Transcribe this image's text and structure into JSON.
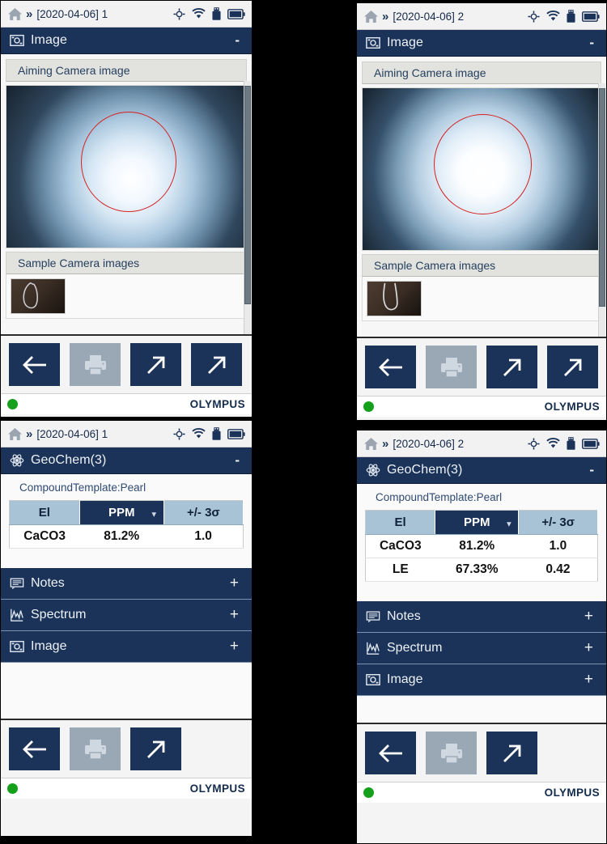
{
  "panels": {
    "tl": {
      "status": {
        "breadcrumb": "[2020-04-06] 1",
        "home_icon": "home-icon",
        "chevron": "»",
        "icons": [
          "gps-icon",
          "wifi-icon",
          "usb-icon",
          "battery-icon"
        ]
      },
      "section": {
        "title": "Image",
        "icon": "image-icon",
        "collapse": "-"
      },
      "sub_aiming": "Aiming Camera image",
      "sub_sample": "Sample Camera images",
      "toolbar": [
        {
          "name": "back-button",
          "icon": "arrow-left-icon",
          "disabled": false
        },
        {
          "name": "print-button",
          "icon": "printer-icon",
          "disabled": true
        },
        {
          "name": "export-button",
          "icon": "arrow-upright-icon",
          "disabled": false
        },
        {
          "name": "share-button",
          "icon": "arrow-upright-icon",
          "disabled": false
        }
      ],
      "footer": {
        "led": "status-led-green",
        "brand": "OLYMPUS"
      }
    },
    "tr": {
      "status": {
        "breadcrumb": "[2020-04-06] 2",
        "home_icon": "home-icon",
        "chevron": "»",
        "icons": [
          "gps-icon",
          "wifi-icon",
          "usb-icon",
          "battery-icon"
        ]
      },
      "section": {
        "title": "Image",
        "icon": "image-icon",
        "collapse": "-"
      },
      "sub_aiming": "Aiming Camera image",
      "sub_sample": "Sample Camera images",
      "toolbar": [
        {
          "name": "back-button",
          "icon": "arrow-left-icon",
          "disabled": false
        },
        {
          "name": "print-button",
          "icon": "printer-icon",
          "disabled": true
        },
        {
          "name": "export-button",
          "icon": "arrow-upright-icon",
          "disabled": false
        },
        {
          "name": "share-button",
          "icon": "arrow-upright-icon",
          "disabled": false
        }
      ],
      "footer": {
        "led": "status-led-green",
        "brand": "OLYMPUS"
      }
    },
    "bl": {
      "status": {
        "breadcrumb": "[2020-04-06] 1",
        "home_icon": "home-icon",
        "chevron": "»",
        "icons": [
          "gps-icon",
          "wifi-icon",
          "usb-icon",
          "battery-icon"
        ]
      },
      "section": {
        "title": "GeoChem(3)",
        "icon": "atom-icon",
        "collapse": "-"
      },
      "template_label": "CompoundTemplate:Pearl",
      "table": {
        "columns": [
          "El",
          "PPM",
          "+/- 3σ"
        ],
        "selected_column": "PPM",
        "rows": [
          {
            "el": "CaCO3",
            "ppm": "81.2%",
            "err": "1.0"
          }
        ]
      },
      "collapsed": [
        {
          "title": "Notes",
          "icon": "notes-icon",
          "expand": "+"
        },
        {
          "title": "Spectrum",
          "icon": "spectrum-icon",
          "expand": "+"
        },
        {
          "title": "Image",
          "icon": "image-icon",
          "expand": "+"
        }
      ],
      "toolbar": [
        {
          "name": "back-button",
          "icon": "arrow-left-icon",
          "disabled": false
        },
        {
          "name": "print-button",
          "icon": "printer-icon",
          "disabled": true
        },
        {
          "name": "export-button",
          "icon": "arrow-upright-icon",
          "disabled": false
        }
      ],
      "footer": {
        "led": "status-led-green",
        "brand": "OLYMPUS"
      }
    },
    "br": {
      "status": {
        "breadcrumb": "[2020-04-06] 2",
        "home_icon": "home-icon",
        "chevron": "»",
        "icons": [
          "gps-icon",
          "wifi-icon",
          "usb-icon",
          "battery-icon"
        ]
      },
      "section": {
        "title": "GeoChem(3)",
        "icon": "atom-icon",
        "collapse": "-"
      },
      "template_label": "CompoundTemplate:Pearl",
      "table": {
        "columns": [
          "El",
          "PPM",
          "+/- 3σ"
        ],
        "selected_column": "PPM",
        "rows": [
          {
            "el": "CaCO3",
            "ppm": "81.2%",
            "err": "1.0"
          },
          {
            "el": "LE",
            "ppm": "67.33%",
            "err": "0.42"
          }
        ]
      },
      "collapsed": [
        {
          "title": "Notes",
          "icon": "notes-icon",
          "expand": "+"
        },
        {
          "title": "Spectrum",
          "icon": "spectrum-icon",
          "expand": "+"
        },
        {
          "title": "Image",
          "icon": "image-icon",
          "expand": "+"
        }
      ],
      "toolbar": [
        {
          "name": "back-button",
          "icon": "arrow-left-icon",
          "disabled": false
        },
        {
          "name": "print-button",
          "icon": "printer-icon",
          "disabled": true
        },
        {
          "name": "export-button",
          "icon": "arrow-upright-icon",
          "disabled": false
        }
      ],
      "footer": {
        "led": "status-led-green",
        "brand": "OLYMPUS"
      }
    }
  },
  "colors": {
    "header_navy": "#1b3359",
    "header_text": "#eef2f7",
    "table_header": "#a9c3d6",
    "led_green": "#14a01a",
    "aim_circle_red": "#d62020",
    "subbar_grey": "#e2e2de"
  }
}
